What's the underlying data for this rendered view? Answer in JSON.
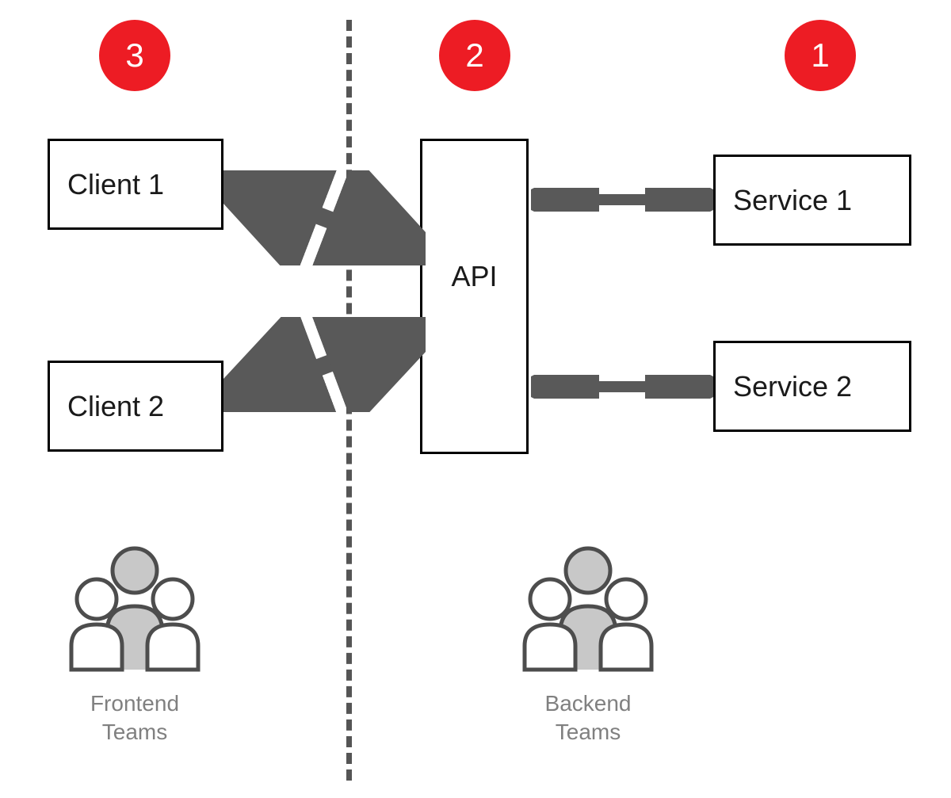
{
  "badges": {
    "left": "3",
    "middle": "2",
    "right": "1"
  },
  "boxes": {
    "client1": "Client 1",
    "client2": "Client 2",
    "api": "API",
    "service1": "Service 1",
    "service2": "Service 2"
  },
  "teams": {
    "frontend": "Frontend\nTeams",
    "backend": "Backend\nTeams"
  },
  "colors": {
    "badge": "#ed1c24",
    "arrow": "#595959",
    "boxBorder": "#000000",
    "teamLabel": "#808080"
  }
}
